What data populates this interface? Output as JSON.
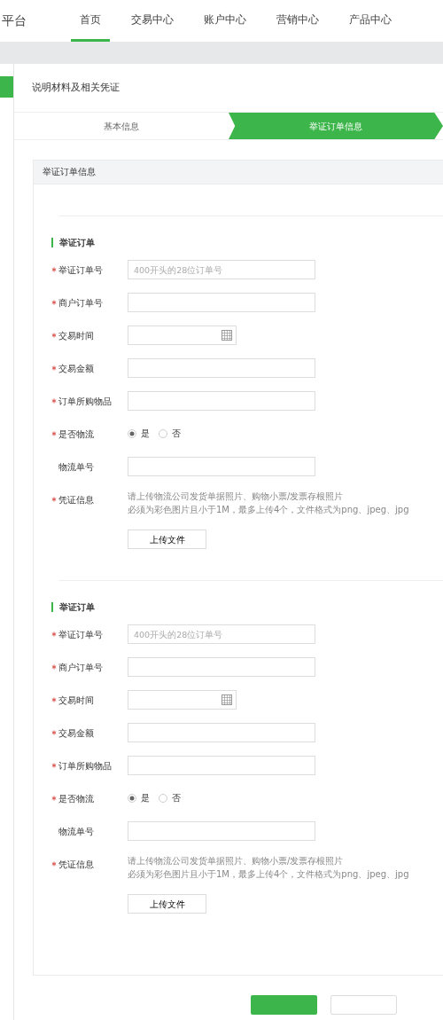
{
  "header": {
    "brand": "平台",
    "nav": [
      {
        "label": "首页",
        "selected": true
      },
      {
        "label": "交易中心",
        "selected": false
      },
      {
        "label": "账户中心",
        "selected": false
      },
      {
        "label": "营销中心",
        "selected": false
      },
      {
        "label": "产品中心",
        "selected": false
      }
    ]
  },
  "page": {
    "title": "说明材料及相关凭证",
    "steps": [
      {
        "label": "基本信息",
        "selected": false
      },
      {
        "label": "举证订单信息",
        "selected": true
      }
    ]
  },
  "panel": {
    "title": "举证订单信息",
    "sections": [
      {
        "title": "举证订单",
        "fields": [
          {
            "kind": "text",
            "label": "举证订单号",
            "required": true,
            "placeholder": "400开头的28位订单号"
          },
          {
            "kind": "text",
            "label": "商户订单号",
            "required": true
          },
          {
            "kind": "date",
            "label": "交易时间",
            "required": true
          },
          {
            "kind": "text",
            "label": "交易金额",
            "required": true
          },
          {
            "kind": "text",
            "label": "订单所购物品",
            "required": true
          },
          {
            "kind": "radio",
            "label": "是否物流",
            "required": true,
            "options": [
              {
                "label": "是",
                "selected": true
              },
              {
                "label": "否",
                "selected": false
              }
            ]
          },
          {
            "kind": "text",
            "label": "物流单号",
            "required": false
          },
          {
            "kind": "upload",
            "label": "凭证信息",
            "required": true,
            "hints": [
              "请上传物流公司发货单据照片、购物小票/发票存根照片",
              "必须为彩色图片且小于1M，最多上传4个，文件格式为png、jpeg、jpg"
            ],
            "button": "上传文件"
          }
        ]
      },
      {
        "title": "举证订单",
        "fields": [
          {
            "kind": "text",
            "label": "举证订单号",
            "required": true,
            "placeholder": "400开头的28位订单号"
          },
          {
            "kind": "text",
            "label": "商户订单号",
            "required": true
          },
          {
            "kind": "date",
            "label": "交易时间",
            "required": true
          },
          {
            "kind": "text",
            "label": "交易金额",
            "required": true
          },
          {
            "kind": "text",
            "label": "订单所购物品",
            "required": true
          },
          {
            "kind": "radio",
            "label": "是否物流",
            "required": true,
            "options": [
              {
                "label": "是",
                "selected": true
              },
              {
                "label": "否",
                "selected": false
              }
            ]
          },
          {
            "kind": "text",
            "label": "物流单号",
            "required": false
          },
          {
            "kind": "upload",
            "label": "凭证信息",
            "required": true,
            "hints": [
              "请上传物流公司发货单据照片、购物小票/发票存根照片",
              "必须为彩色图片且小于1M，最多上传4个，文件格式为png、jpeg、jpg"
            ],
            "button": "上传文件"
          }
        ]
      }
    ]
  },
  "footer": {
    "buttons": [
      {
        "kind": "primary"
      },
      {
        "kind": "secondary"
      }
    ]
  }
}
